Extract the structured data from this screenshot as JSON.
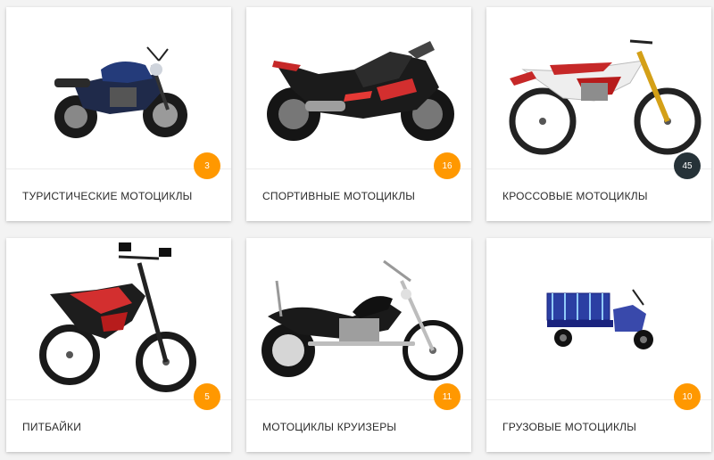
{
  "colors": {
    "badge_default": "#ff9800",
    "badge_active": "#263238"
  },
  "categories": [
    {
      "label": "ТУРИСТИЧЕСКИЕ МОТОЦИКЛЫ",
      "count": "3",
      "icon": "touring-motorcycle-icon"
    },
    {
      "label": "СПОРТИВНЫЕ МОТОЦИКЛЫ",
      "count": "16",
      "icon": "sport-motorcycle-icon"
    },
    {
      "label": "КРОССОВЫЕ МОТОЦИКЛЫ",
      "count": "45",
      "icon": "motocross-bike-icon"
    },
    {
      "label": "ПИТБАЙКИ",
      "count": "5",
      "icon": "pit-bike-icon"
    },
    {
      "label": "МОТОЦИКЛЫ КРУИЗЕРЫ",
      "count": "11",
      "icon": "cruiser-motorcycle-icon"
    },
    {
      "label": "ГРУЗОВЫЕ МОТОЦИКЛЫ",
      "count": "10",
      "icon": "cargo-tricycle-icon"
    }
  ]
}
